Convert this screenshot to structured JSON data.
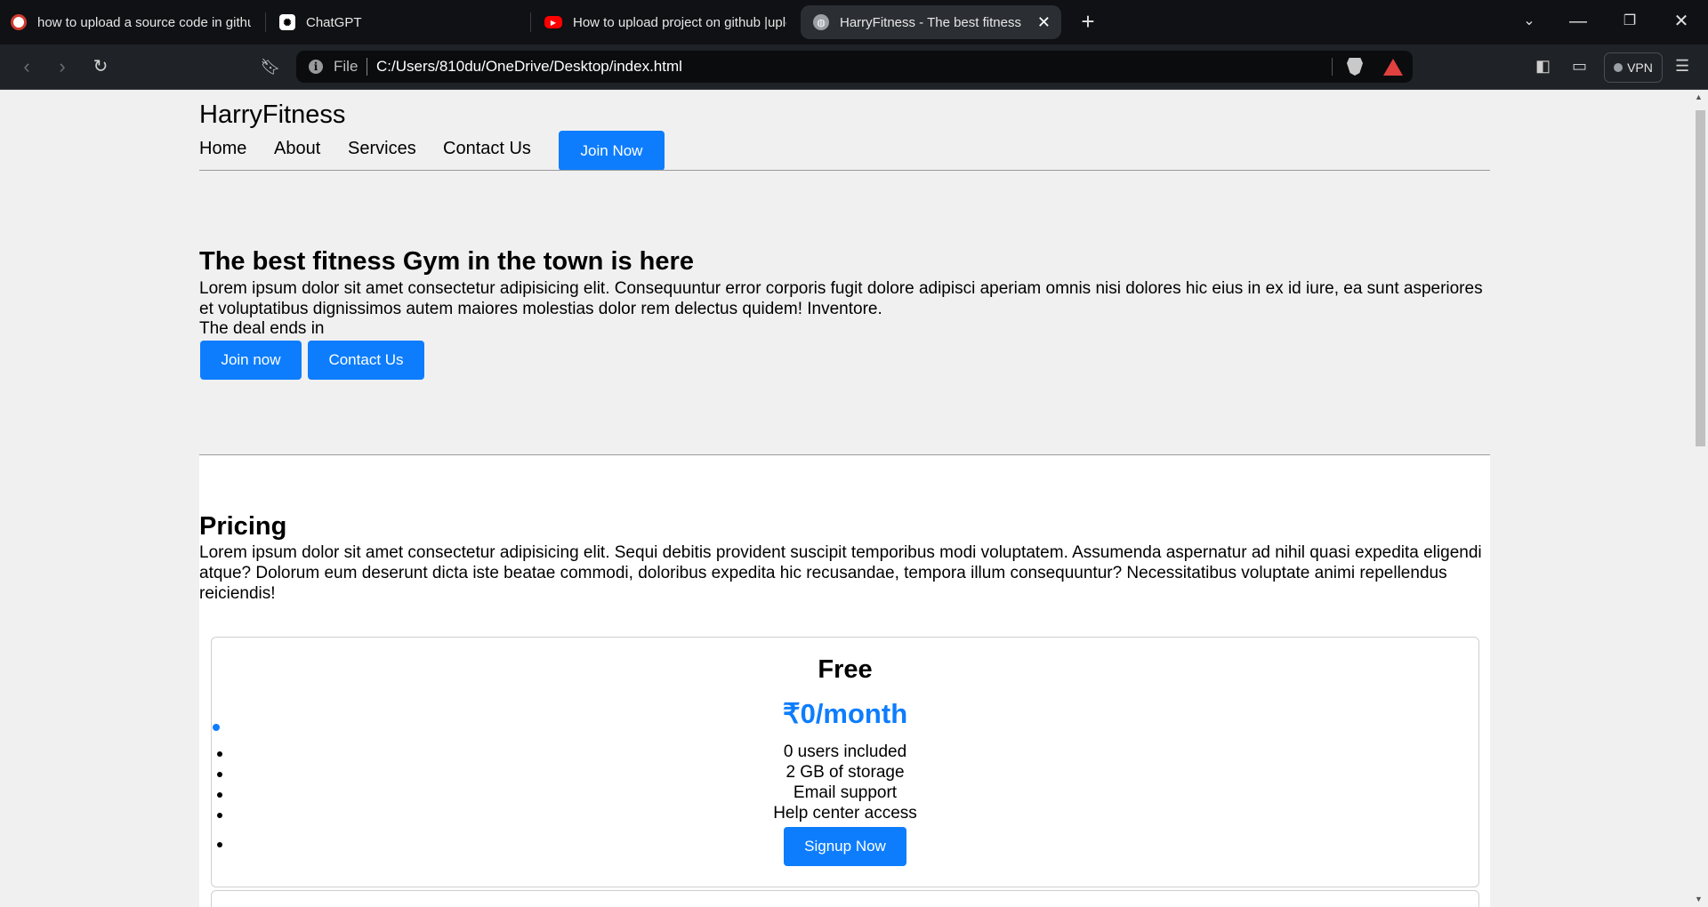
{
  "browser": {
    "tabs": [
      {
        "title": "how to upload a source code in github",
        "icon": "brave-shield-icon",
        "active": false
      },
      {
        "title": "ChatGPT",
        "icon": "chatgpt-icon",
        "active": false
      },
      {
        "title": "How to upload project on github |upload",
        "icon": "youtube-icon",
        "active": false
      },
      {
        "title": "HarryFitness - The best fitness gym",
        "icon": "globe-icon",
        "active": true
      }
    ],
    "address": {
      "scheme_label": "File",
      "url": "C:/Users/810du/OneDrive/Desktop/index.html"
    },
    "vpn_label": "VPN"
  },
  "site": {
    "brand": "HarryFitness",
    "nav": [
      "Home",
      "About",
      "Services",
      "Contact Us"
    ],
    "join_button": "Join Now",
    "hero": {
      "heading": "The best fitness Gym in the town is here",
      "text": "Lorem ipsum dolor sit amet consectetur adipisicing elit. Consequuntur error corporis fugit dolore adipisci aperiam omnis nisi dolores hic eius in ex id iure, ea sunt asperiores et voluptatibus dignissimos autem maiores molestias dolor rem delectus quidem! Inventore.",
      "deal": "The deal ends in",
      "buttons": [
        "Join now",
        "Contact Us"
      ]
    },
    "pricing": {
      "heading": "Pricing",
      "text": "Lorem ipsum dolor sit amet consectetur adipisicing elit. Sequi debitis provident suscipit temporibus modi voluptatem. Assumenda aspernatur ad nihil quasi expedita eligendi atque? Dolorum eum deserunt dicta iste beatae commodi, doloribus expedita hic recusandae, tempora illum consequuntur? Necessitatibus voluptate animi repellendus reiciendis!",
      "plan": {
        "name": "Free",
        "price": "₹0/month",
        "features": [
          "0 users included",
          "2 GB of storage",
          "Email support",
          "Help center access"
        ],
        "button": "Signup Now"
      }
    }
  },
  "colors": {
    "accent": "#0d7dfd",
    "chrome_bg": "#0f1114",
    "page_bg": "#f0f0f0"
  }
}
